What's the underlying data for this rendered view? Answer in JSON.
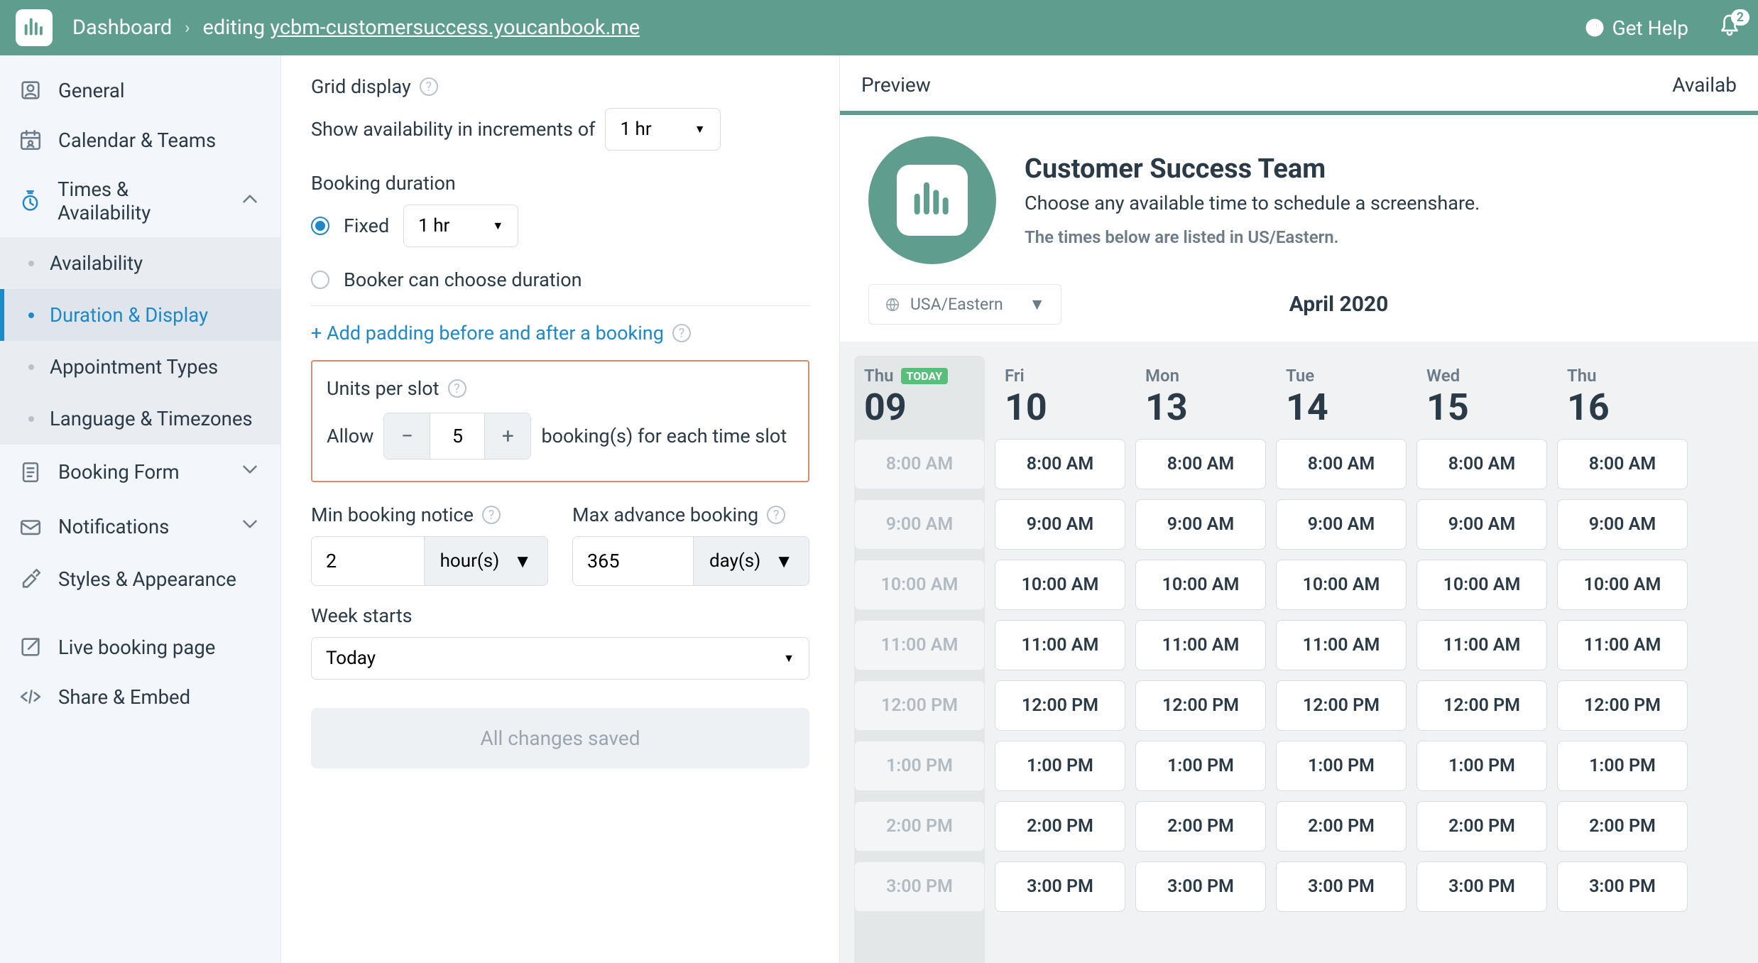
{
  "header": {
    "dashboard": "Dashboard",
    "editing_prefix": "editing",
    "url": "ycbm-customersuccess.youcanbook.me",
    "get_help": "Get Help",
    "notif_count": "2"
  },
  "sidebar": {
    "items": [
      {
        "label": "General"
      },
      {
        "label": "Calendar & Teams"
      },
      {
        "label": "Times & Availability",
        "expanded": true
      },
      {
        "label": "Booking Form",
        "expandable": true
      },
      {
        "label": "Notifications",
        "expandable": true
      },
      {
        "label": "Styles & Appearance"
      }
    ],
    "sub_times": [
      {
        "label": "Availability"
      },
      {
        "label": "Duration & Display",
        "active": true
      },
      {
        "label": "Appointment Types"
      },
      {
        "label": "Language & Timezones"
      }
    ],
    "live_booking": "Live booking page",
    "share_embed": "Share & Embed"
  },
  "settings": {
    "grid_display": "Grid display",
    "show_avail_text": "Show availability in increments of",
    "show_avail_value": "1 hr",
    "booking_duration": "Booking duration",
    "fixed_label": "Fixed",
    "fixed_value": "1 hr",
    "booker_choose": "Booker can choose duration",
    "add_padding": "+ Add padding before and after a booking",
    "units_per_slot": "Units per slot",
    "allow": "Allow",
    "units_value": "5",
    "units_suffix": "booking(s) for each time slot",
    "min_notice": "Min booking notice",
    "min_notice_value": "2",
    "min_notice_unit": "hour(s)",
    "max_advance": "Max advance booking",
    "max_advance_value": "365",
    "max_advance_unit": "day(s)",
    "week_starts": "Week starts",
    "week_starts_value": "Today",
    "saved": "All changes saved"
  },
  "preview": {
    "tab_preview": "Preview",
    "tab_avail": "Availab",
    "title": "Customer Success Team",
    "subtitle": "Choose any available time to schedule a screenshare.",
    "tz_note": "The times below are listed in US/Eastern.",
    "tz_value": "USA/Eastern",
    "month": "April 2020",
    "today_badge": "TODAY",
    "days": [
      {
        "dow": "Thu",
        "num": "09",
        "today": true,
        "disabled": true
      },
      {
        "dow": "Fri",
        "num": "10"
      },
      {
        "dow": "Mon",
        "num": "13"
      },
      {
        "dow": "Tue",
        "num": "14"
      },
      {
        "dow": "Wed",
        "num": "15"
      },
      {
        "dow": "Thu",
        "num": "16"
      }
    ],
    "times": [
      "8:00 AM",
      "9:00 AM",
      "10:00 AM",
      "11:00 AM",
      "12:00 PM",
      "1:00 PM",
      "2:00 PM",
      "3:00 PM"
    ]
  }
}
